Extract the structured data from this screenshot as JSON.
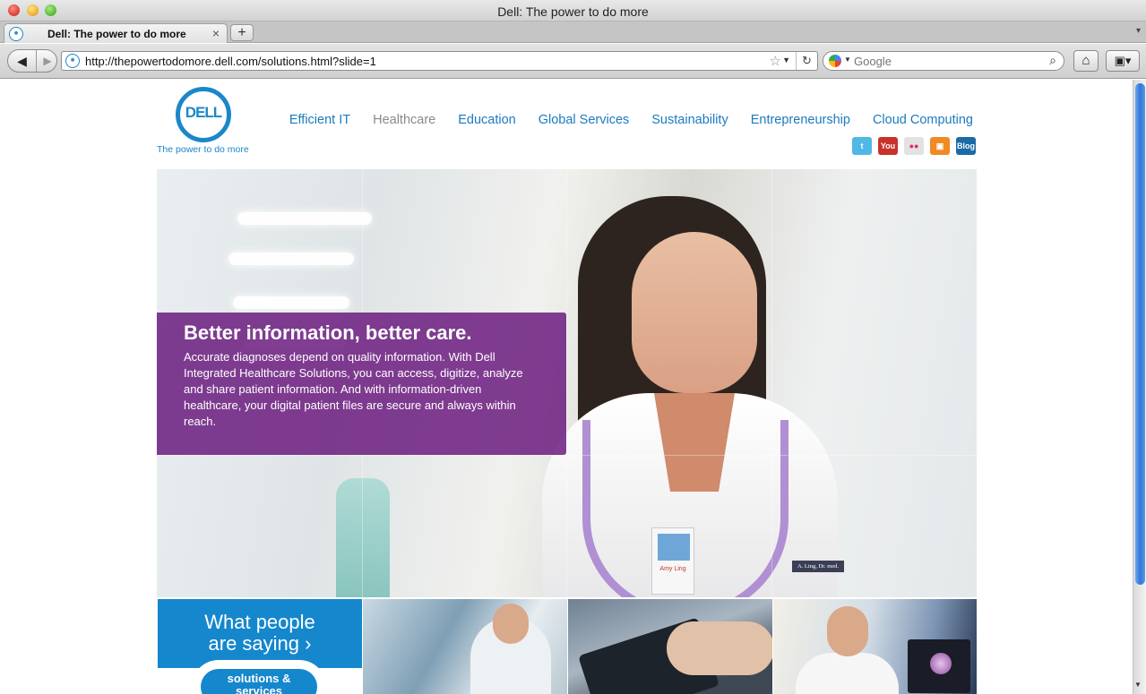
{
  "window": {
    "title": "Dell: The power to do more"
  },
  "tabs": [
    {
      "label": "Dell: The power to do more",
      "close": "×"
    }
  ],
  "tabbar": {
    "new_tab": "+",
    "list": "▾"
  },
  "toolbar": {
    "back": "◀",
    "forward": "▶",
    "url": "http://thepowertodomore.dell.com/solutions.html?slide=1",
    "star": "☆",
    "url_dropdown": "▼",
    "reload": "↻",
    "search_placeholder": "Google",
    "search_engine_drop": "▼",
    "search_glyph": "⌕",
    "home": "⌂",
    "bookmarks": "▣▾"
  },
  "site": {
    "logo_word": "DELL",
    "tagline": "The power to do more",
    "nav": [
      {
        "label": "Efficient IT",
        "current": false
      },
      {
        "label": "Healthcare",
        "current": true
      },
      {
        "label": "Education",
        "current": false
      },
      {
        "label": "Global Services",
        "current": false
      },
      {
        "label": "Sustainability",
        "current": false
      },
      {
        "label": "Entrepreneurship",
        "current": false
      },
      {
        "label": "Cloud Computing",
        "current": false
      }
    ],
    "social": [
      {
        "icon": "twitter-icon",
        "glyph": "t",
        "color": "#4fb8e6"
      },
      {
        "icon": "youtube-icon",
        "glyph": "You",
        "color": "#c8322b"
      },
      {
        "icon": "flickr-icon",
        "glyph": "●●",
        "color": "#e2e2e2"
      },
      {
        "icon": "slideshare-icon",
        "glyph": "▣",
        "color": "#f08a24"
      },
      {
        "icon": "blog-icon",
        "glyph": "Blog",
        "color": "#1a6aa6"
      }
    ]
  },
  "hero": {
    "headline": "Better information, better care.",
    "body": "Accurate diagnoses depend on quality information. With Dell Integrated Healthcare Solutions, you can access, digitize, analyze and share patient information. And with information-driven healthcare, your digital patient files are secure and always within reach.",
    "badge_name": "Amy Ling",
    "name_tag": "A. Ling, Dr. med."
  },
  "tiles": {
    "people_line1": "What people",
    "people_line2": "are saying ›",
    "solutions_line1": "solutions &",
    "solutions_line2": "services"
  },
  "colors": {
    "dell_blue": "#1b87c9",
    "caption_purple": "#6e2282",
    "tile_blue": "#1587cd"
  }
}
